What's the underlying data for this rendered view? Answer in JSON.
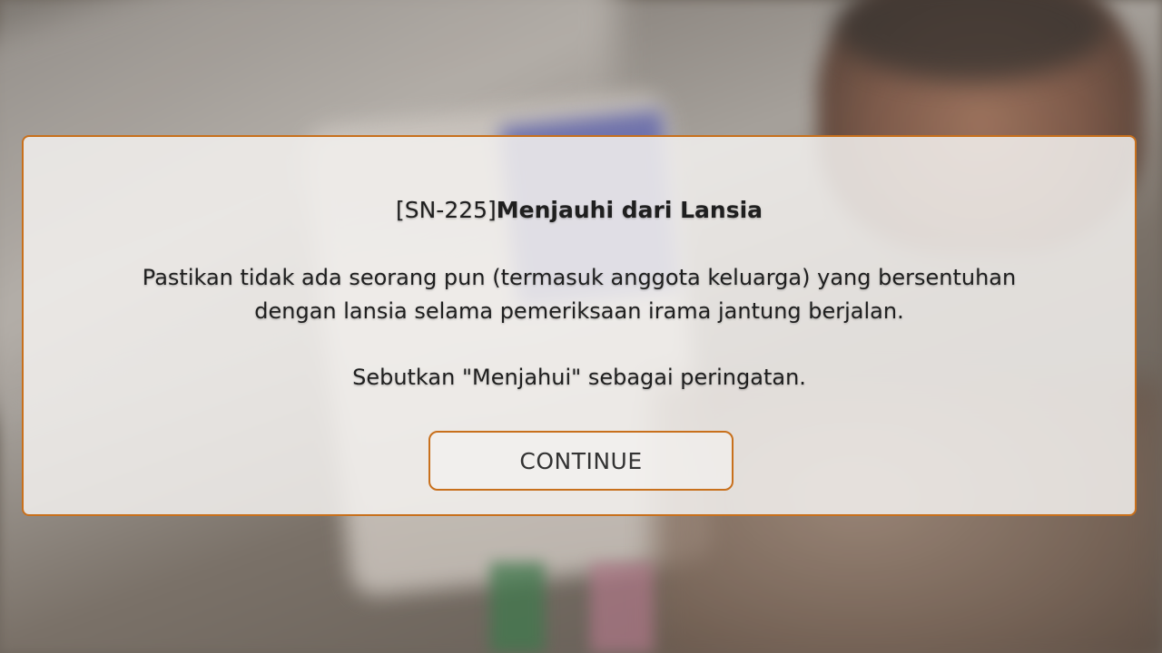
{
  "dialog": {
    "title_code": "[SN-225]",
    "title_name": "Menjauhi dari Lansia",
    "body_line1": "Pastikan tidak ada seorang pun (termasuk anggota keluarga) yang bersentuhan",
    "body_line2": "dengan lansia selama pemeriksaan irama jantung berjalan.",
    "note": "Sebutkan \"Menjahui\" sebagai peringatan.",
    "continue_label": "CONTINUE"
  },
  "colors": {
    "accent_border": "#c8701c",
    "panel_background": "#f2f0ee",
    "text": "#1f1f1f"
  }
}
